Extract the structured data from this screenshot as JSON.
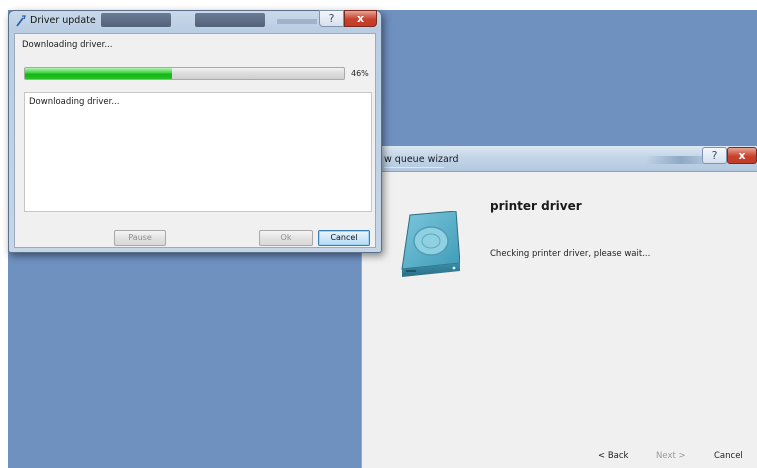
{
  "driver_dialog": {
    "title": "Driver update",
    "status_label": "Downloading driver...",
    "progress_fraction": 0.46,
    "progress_text": "46%",
    "log_text": "Downloading driver...",
    "buttons": {
      "pause": "Pause",
      "ok": "Ok",
      "cancel": "Cancel"
    },
    "help_glyph": "?",
    "close_glyph": "x"
  },
  "wizard": {
    "title_partial": "w queue wizard",
    "heading": "printer driver",
    "status": "Checking printer driver, please wait...",
    "icon": "hard-disk-icon",
    "buttons": {
      "back": "< Back",
      "next": "Next >",
      "cancel": "Cancel"
    },
    "help_glyph": "?",
    "close_glyph": "x"
  },
  "colors": {
    "desktop": "#6f91c0",
    "progress_green": "#16b416",
    "close_red": "#c7412c",
    "focus_blue": "#3c7fb1"
  }
}
